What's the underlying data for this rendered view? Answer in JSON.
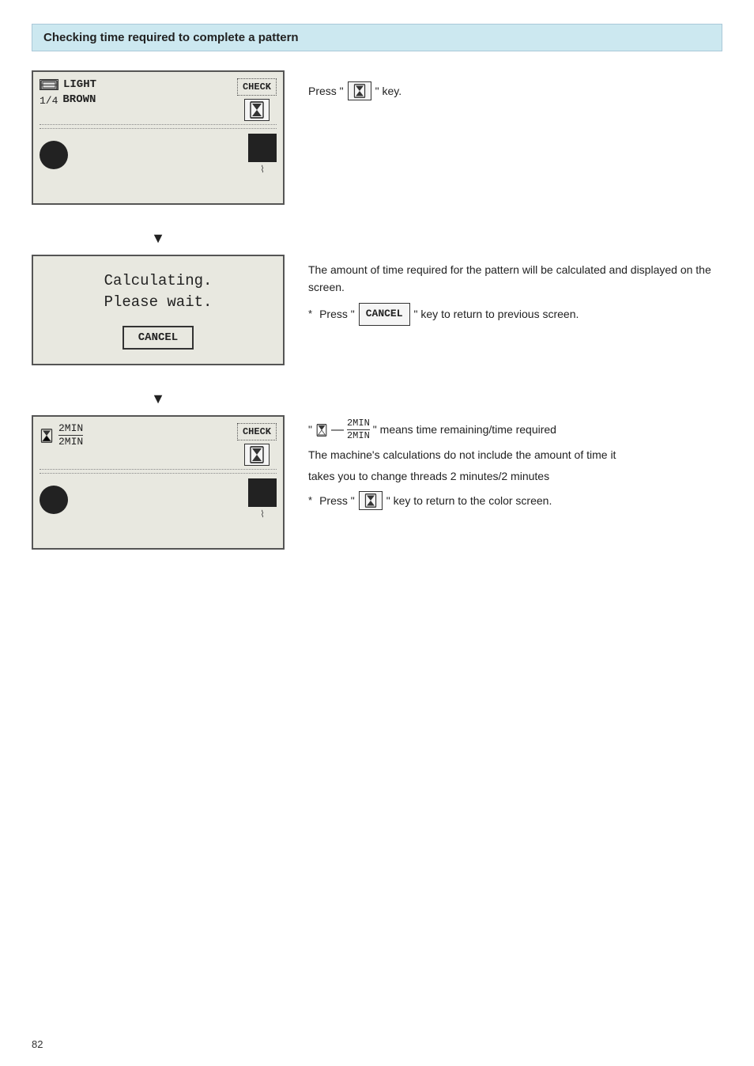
{
  "header": {
    "title": "Checking time required to complete a pattern"
  },
  "step1": {
    "screen": {
      "count": "1/4",
      "color_line1": "LIGHT",
      "color_line2": "BROWN",
      "check_label": "CHECK"
    },
    "desc": {
      "press_prefix": "Press \"",
      "press_suffix": "\" key."
    }
  },
  "step2": {
    "screen": {
      "line1": "Calculating.",
      "line2": "Please wait.",
      "cancel_label": "CANCEL"
    },
    "desc": {
      "text": "The amount of time required for the pattern will be calculated and displayed on the screen.",
      "note": "Press \"",
      "note_key": "CANCEL",
      "note_suffix": "\" key to return to previous screen."
    }
  },
  "step3": {
    "screen": {
      "time_top": "2MIN",
      "time_bottom": "2MIN",
      "check_label": "CHECK"
    },
    "desc": {
      "means_text": "\" means   time remaining/time required",
      "line2": "The machine's calculations do not include the amount of time it",
      "line3": "takes you to change threads 2 minutes/2 minutes",
      "note_prefix": "Press \"",
      "note_suffix": "\" key to return to the color screen."
    }
  },
  "page_number": "82"
}
